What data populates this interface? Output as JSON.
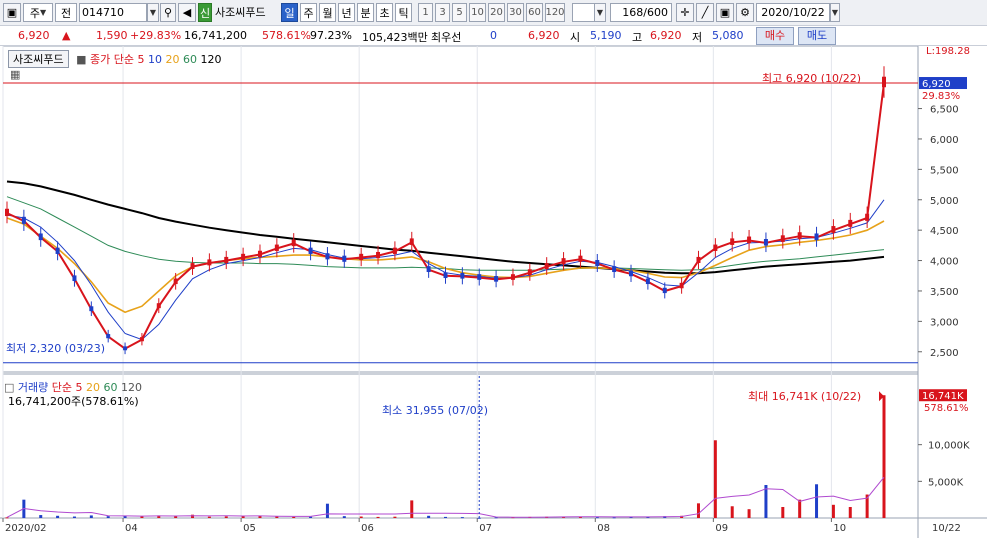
{
  "toolbar": {
    "market": "주",
    "kind": "전",
    "code": "014710",
    "sound_icon": "speaker-icon",
    "new_badge": "신",
    "stock_name": "사조씨푸드",
    "periods": [
      "일",
      "주",
      "월",
      "년",
      "분",
      "초",
      "틱"
    ],
    "selected_period": "일",
    "intervals": [
      "1",
      "3",
      "5",
      "10",
      "20",
      "30",
      "60",
      "120"
    ],
    "range_count": "168/600",
    "date": "2020/10/22"
  },
  "quote": {
    "price": "6,920",
    "change": "1,590",
    "change_rate": "+29.83%",
    "volume": "16,741,200",
    "volume_rate": "578.61%",
    "ratio": "97.23%",
    "amount": "105,423백만",
    "preferred_label": "최우선",
    "preferred_value": "0",
    "preferred_price": "6,920",
    "open_label": "시",
    "open": "5,190",
    "high_label": "고",
    "high": "6,920",
    "low_label": "저",
    "low": "5,080",
    "buy_label": "매수",
    "sell_label": "매도"
  },
  "price_panel": {
    "title": "사조씨푸드",
    "ma_label": "종가 단순",
    "ma_periods": [
      "5",
      "10",
      "20",
      "60",
      "120"
    ],
    "high_annotation": "최고 6,920 (10/22)",
    "low_annotation": "최저 2,320 (03/23)",
    "current_tag": "6,920",
    "current_pct": "29.83%",
    "top_tag": "L:198.28"
  },
  "volume_panel": {
    "label": "거래량",
    "ma_label": "단순",
    "ma_periods": [
      "5",
      "20",
      "60",
      "120"
    ],
    "current_text": "16,741,200주(578.61%)",
    "min_annotation": "최소 31,955 (07/02)",
    "max_annotation": "최대 16,741K (10/22)",
    "current_tag": "16,741K",
    "current_pct": "578.61%"
  },
  "colors": {
    "up": "#d8141c",
    "down": "#1f3fc8",
    "ma5": "#d8141c",
    "ma10": "#1f3fc8",
    "ma20": "#e7a21a",
    "ma60": "#2e8b57",
    "ma120": "#000000"
  },
  "chart_data": [
    {
      "type": "candlestick",
      "title": "사조씨푸드",
      "x_ticks": [
        "2020/02",
        "04",
        "05",
        "06",
        "07",
        "08",
        "09",
        "10"
      ],
      "x_end_label": "10/22",
      "y_ticks": [
        2500,
        3000,
        3500,
        4000,
        4500,
        5000,
        5500,
        6000,
        6500
      ],
      "ylim": [
        2200,
        7200
      ],
      "high": 6920,
      "low": 2320,
      "series": [
        {
          "name": "5",
          "values": [
            4780,
            4650,
            4380,
            4150,
            3700,
            3200,
            2750,
            2550,
            2700,
            3250,
            3650,
            3900,
            3960,
            4000,
            4050,
            4100,
            4200,
            4280,
            4150,
            4060,
            4020,
            4050,
            4080,
            4150,
            4300,
            3850,
            3750,
            3740,
            3720,
            3690,
            3720,
            3800,
            3900,
            3980,
            4020,
            3950,
            3850,
            3780,
            3650,
            3500,
            3580,
            4000,
            4200,
            4300,
            4330,
            4290,
            4350,
            4400,
            4380,
            4500,
            4600,
            4700,
            6920
          ]
        },
        {
          "name": "10",
          "values": [
            4750,
            4700,
            4550,
            4300,
            4000,
            3600,
            3150,
            2800,
            2700,
            2950,
            3350,
            3700,
            3850,
            3950,
            4000,
            4050,
            4130,
            4200,
            4180,
            4100,
            4040,
            4030,
            4050,
            4090,
            4150,
            3950,
            3800,
            3760,
            3740,
            3710,
            3720,
            3760,
            3850,
            3930,
            3990,
            3970,
            3900,
            3820,
            3720,
            3600,
            3580,
            3800,
            4050,
            4200,
            4290,
            4300,
            4320,
            4360,
            4380,
            4450,
            4530,
            4620,
            5000
          ]
        },
        {
          "name": "20",
          "values": [
            4700,
            4600,
            4400,
            4200,
            3950,
            3650,
            3300,
            3150,
            3250,
            3500,
            3750,
            3900,
            3960,
            4000,
            4030,
            4050,
            4070,
            4090,
            4090,
            4060,
            4030,
            4010,
            4010,
            4030,
            4060,
            3980,
            3870,
            3800,
            3760,
            3730,
            3720,
            3740,
            3790,
            3840,
            3880,
            3880,
            3870,
            3840,
            3790,
            3730,
            3720,
            3800,
            3920,
            4050,
            4170,
            4230,
            4260,
            4300,
            4330,
            4370,
            4420,
            4500,
            4650
          ]
        },
        {
          "name": "60",
          "values": [
            5050,
            4950,
            4850,
            4700,
            4550,
            4400,
            4250,
            4150,
            4080,
            4020,
            3990,
            3970,
            3960,
            3960,
            3960,
            3950,
            3950,
            3940,
            3920,
            3900,
            3890,
            3880,
            3880,
            3880,
            3890,
            3880,
            3870,
            3850,
            3840,
            3840,
            3840,
            3840,
            3850,
            3860,
            3870,
            3880,
            3880,
            3870,
            3860,
            3850,
            3840,
            3850,
            3880,
            3920,
            3960,
            3990,
            4010,
            4030,
            4060,
            4090,
            4120,
            4150,
            4180
          ]
        },
        {
          "name": "120",
          "values": [
            5300,
            5270,
            5220,
            5150,
            5080,
            5000,
            4920,
            4850,
            4780,
            4700,
            4640,
            4590,
            4540,
            4500,
            4460,
            4420,
            4390,
            4360,
            4330,
            4300,
            4270,
            4240,
            4210,
            4180,
            4160,
            4130,
            4100,
            4070,
            4040,
            4010,
            3980,
            3960,
            3940,
            3920,
            3900,
            3880,
            3860,
            3840,
            3820,
            3800,
            3790,
            3790,
            3810,
            3840,
            3870,
            3900,
            3920,
            3940,
            3960,
            3980,
            4000,
            4030,
            4060
          ]
        }
      ]
    },
    {
      "type": "bar",
      "title": "거래량",
      "y_ticks": [
        5000,
        10000
      ],
      "y_tick_labels": [
        "5,000K",
        "10,000K"
      ],
      "ylim": [
        0,
        18000
      ],
      "unit": "K",
      "values": [
        90,
        2500,
        400,
        300,
        200,
        350,
        250,
        300,
        200,
        350,
        280,
        450,
        180,
        220,
        250,
        300,
        200,
        150,
        180,
        1950,
        250,
        200,
        150,
        180,
        2400,
        300,
        150,
        120,
        32,
        100,
        120,
        150,
        180,
        200,
        150,
        120,
        100,
        150,
        200,
        250,
        300,
        2000,
        10600,
        1600,
        1200,
        4500,
        1500,
        2500,
        4600,
        1800,
        1500,
        3200,
        16741
      ]
    }
  ]
}
